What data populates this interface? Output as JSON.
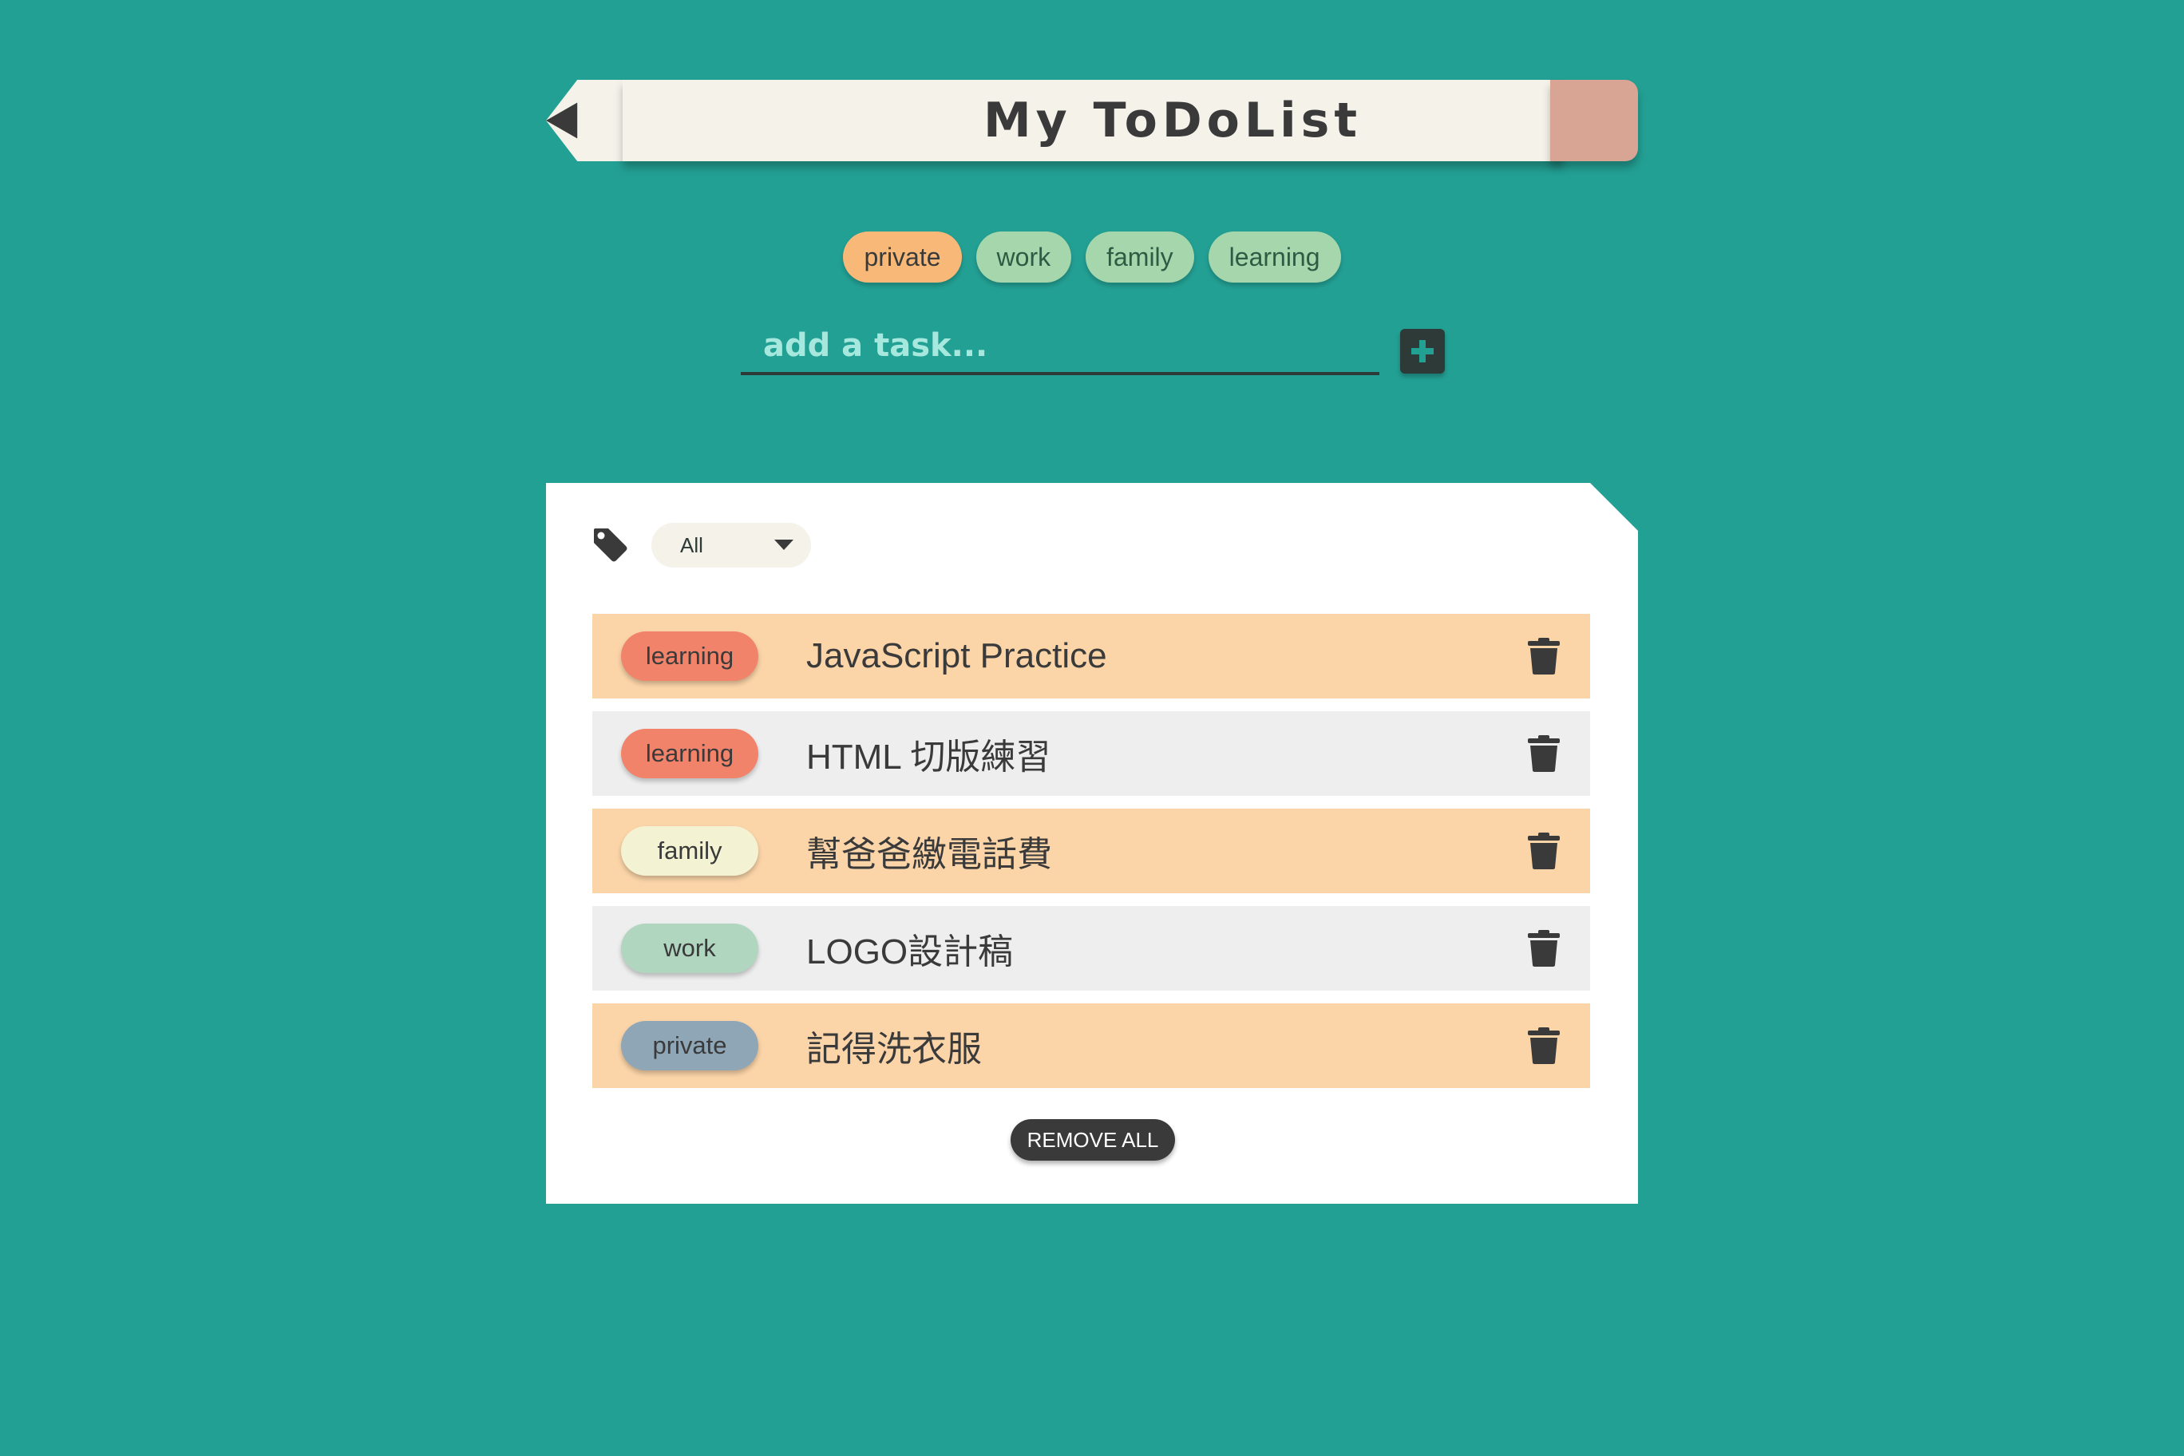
{
  "header": {
    "title": "My ToDoList"
  },
  "categories": [
    {
      "label": "private",
      "active": true
    },
    {
      "label": "work",
      "active": false
    },
    {
      "label": "family",
      "active": false
    },
    {
      "label": "learning",
      "active": false
    }
  ],
  "add_task": {
    "placeholder": "add a task...",
    "value": "",
    "button_icon": "plus-icon"
  },
  "filter": {
    "icon": "tag-icon",
    "selected": "All",
    "arrow_icon": "caret-down-icon"
  },
  "tasks": [
    {
      "tag": "learning",
      "text": "JavaScript Practice",
      "tag_color": "#f2836b",
      "row_color": "#fbd4a8"
    },
    {
      "tag": "learning",
      "text": "HTML 切版練習",
      "tag_color": "#f2836b",
      "row_color": "#eeeeee"
    },
    {
      "tag": "family",
      "text": "幫爸爸繳電話費",
      "tag_color": "#f3f3d3",
      "row_color": "#fbd4a8"
    },
    {
      "tag": "work",
      "text": "LOGO設計稿",
      "tag_color": "#b0d6c0",
      "row_color": "#eeeeee"
    },
    {
      "tag": "private",
      "text": "記得洗衣服",
      "tag_color": "#8fa6b6",
      "row_color": "#fbd4a8"
    }
  ],
  "remove_all_label": "REMOVE ALL",
  "colors": {
    "background": "#23a094",
    "pencil_body": "#f4f2e9",
    "eraser": "#d8a494",
    "chip_default": "#a6d6ab",
    "chip_active": "#f8b978",
    "dark": "#3a3a3a"
  }
}
